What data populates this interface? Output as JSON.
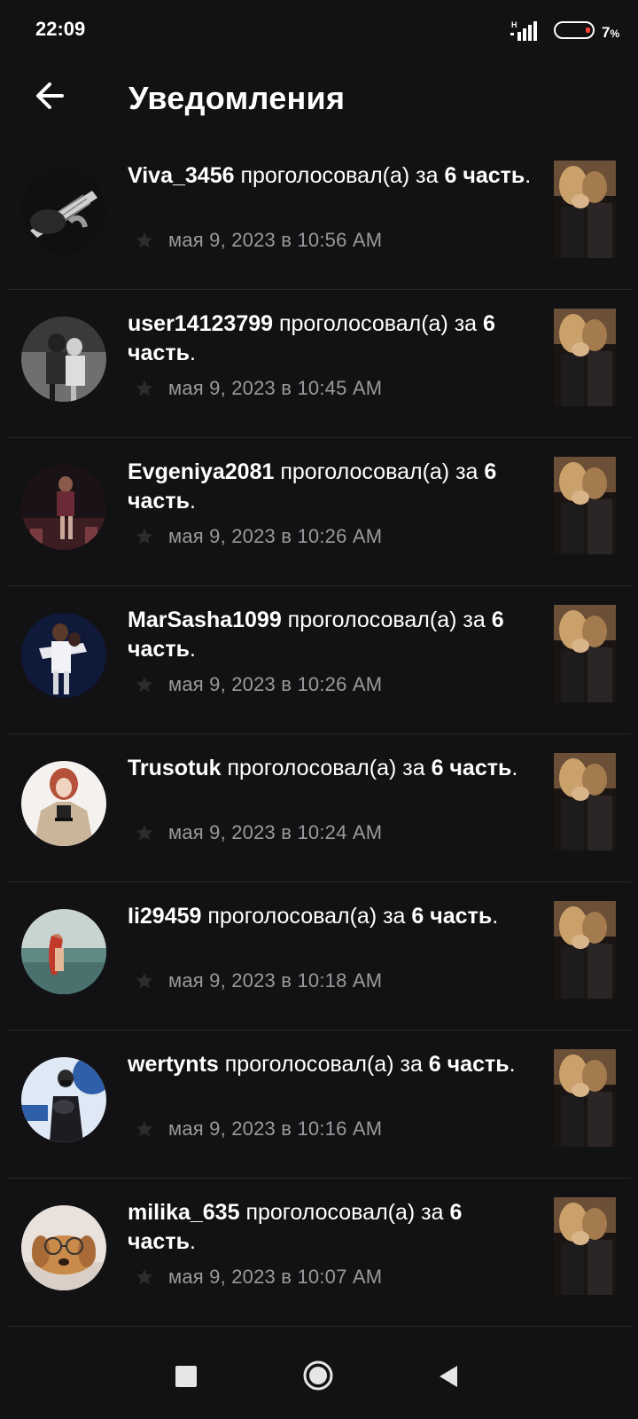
{
  "status_bar": {
    "time": "22:09",
    "network_label": "H",
    "battery_percent": "7",
    "battery_percent_sign": "%"
  },
  "header": {
    "title": "Уведомления",
    "back_icon": "arrow-left-icon"
  },
  "notifications": [
    {
      "user": "Viva_3456",
      "action": " проголосовал(а) за ",
      "part_number": "6",
      "part_word": " часть",
      "period": ".",
      "time": "мая 9, 2023 в 10:56 AM"
    },
    {
      "user": "user14123799",
      "action": " проголосовал(а) за ",
      "part_number": "6",
      "part_word": " часть",
      "period": ".",
      "time": "мая 9, 2023 в 10:45 AM"
    },
    {
      "user": "Evgeniya2081",
      "action": " проголосовал(а) за ",
      "part_number": "6",
      "part_word": " часть",
      "period": ".",
      "time": "мая 9, 2023 в 10:26 AM"
    },
    {
      "user": "MarSasha1099",
      "action": " проголосовал(а) за ",
      "part_number": "6",
      "part_word": " часть",
      "period": ".",
      "time": "мая 9, 2023 в 10:26 AM"
    },
    {
      "user": "Trusotuk",
      "action": " проголосовал(а) за ",
      "part_number": "6",
      "part_word": " часть",
      "period": ".",
      "time": "мая 9, 2023 в 10:24 AM"
    },
    {
      "user": "Ii29459",
      "action": " проголосовал(а) за ",
      "part_number": "6",
      "part_word": " часть",
      "period": ".",
      "time": "мая 9, 2023 в 10:18 AM"
    },
    {
      "user": "wertynts",
      "action": " проголосовал(а) за ",
      "part_number": "6",
      "part_word": " часть",
      "period": ".",
      "time": "мая 9, 2023 в 10:16 AM"
    },
    {
      "user": "milika_635",
      "action": " проголосовал(а) за ",
      "part_number": "6",
      "part_word": " часть",
      "period": ".",
      "time": "мая 9, 2023 в 10:07 AM"
    }
  ],
  "colors": {
    "background": "#121113",
    "text_primary": "#ffffff",
    "text_secondary": "#9a999c",
    "divider": "#2a292c",
    "battery_low": "#ff4530"
  },
  "nav": {
    "recents_icon": "square-icon",
    "home_icon": "circle-icon",
    "back_icon": "triangle-back-icon"
  }
}
